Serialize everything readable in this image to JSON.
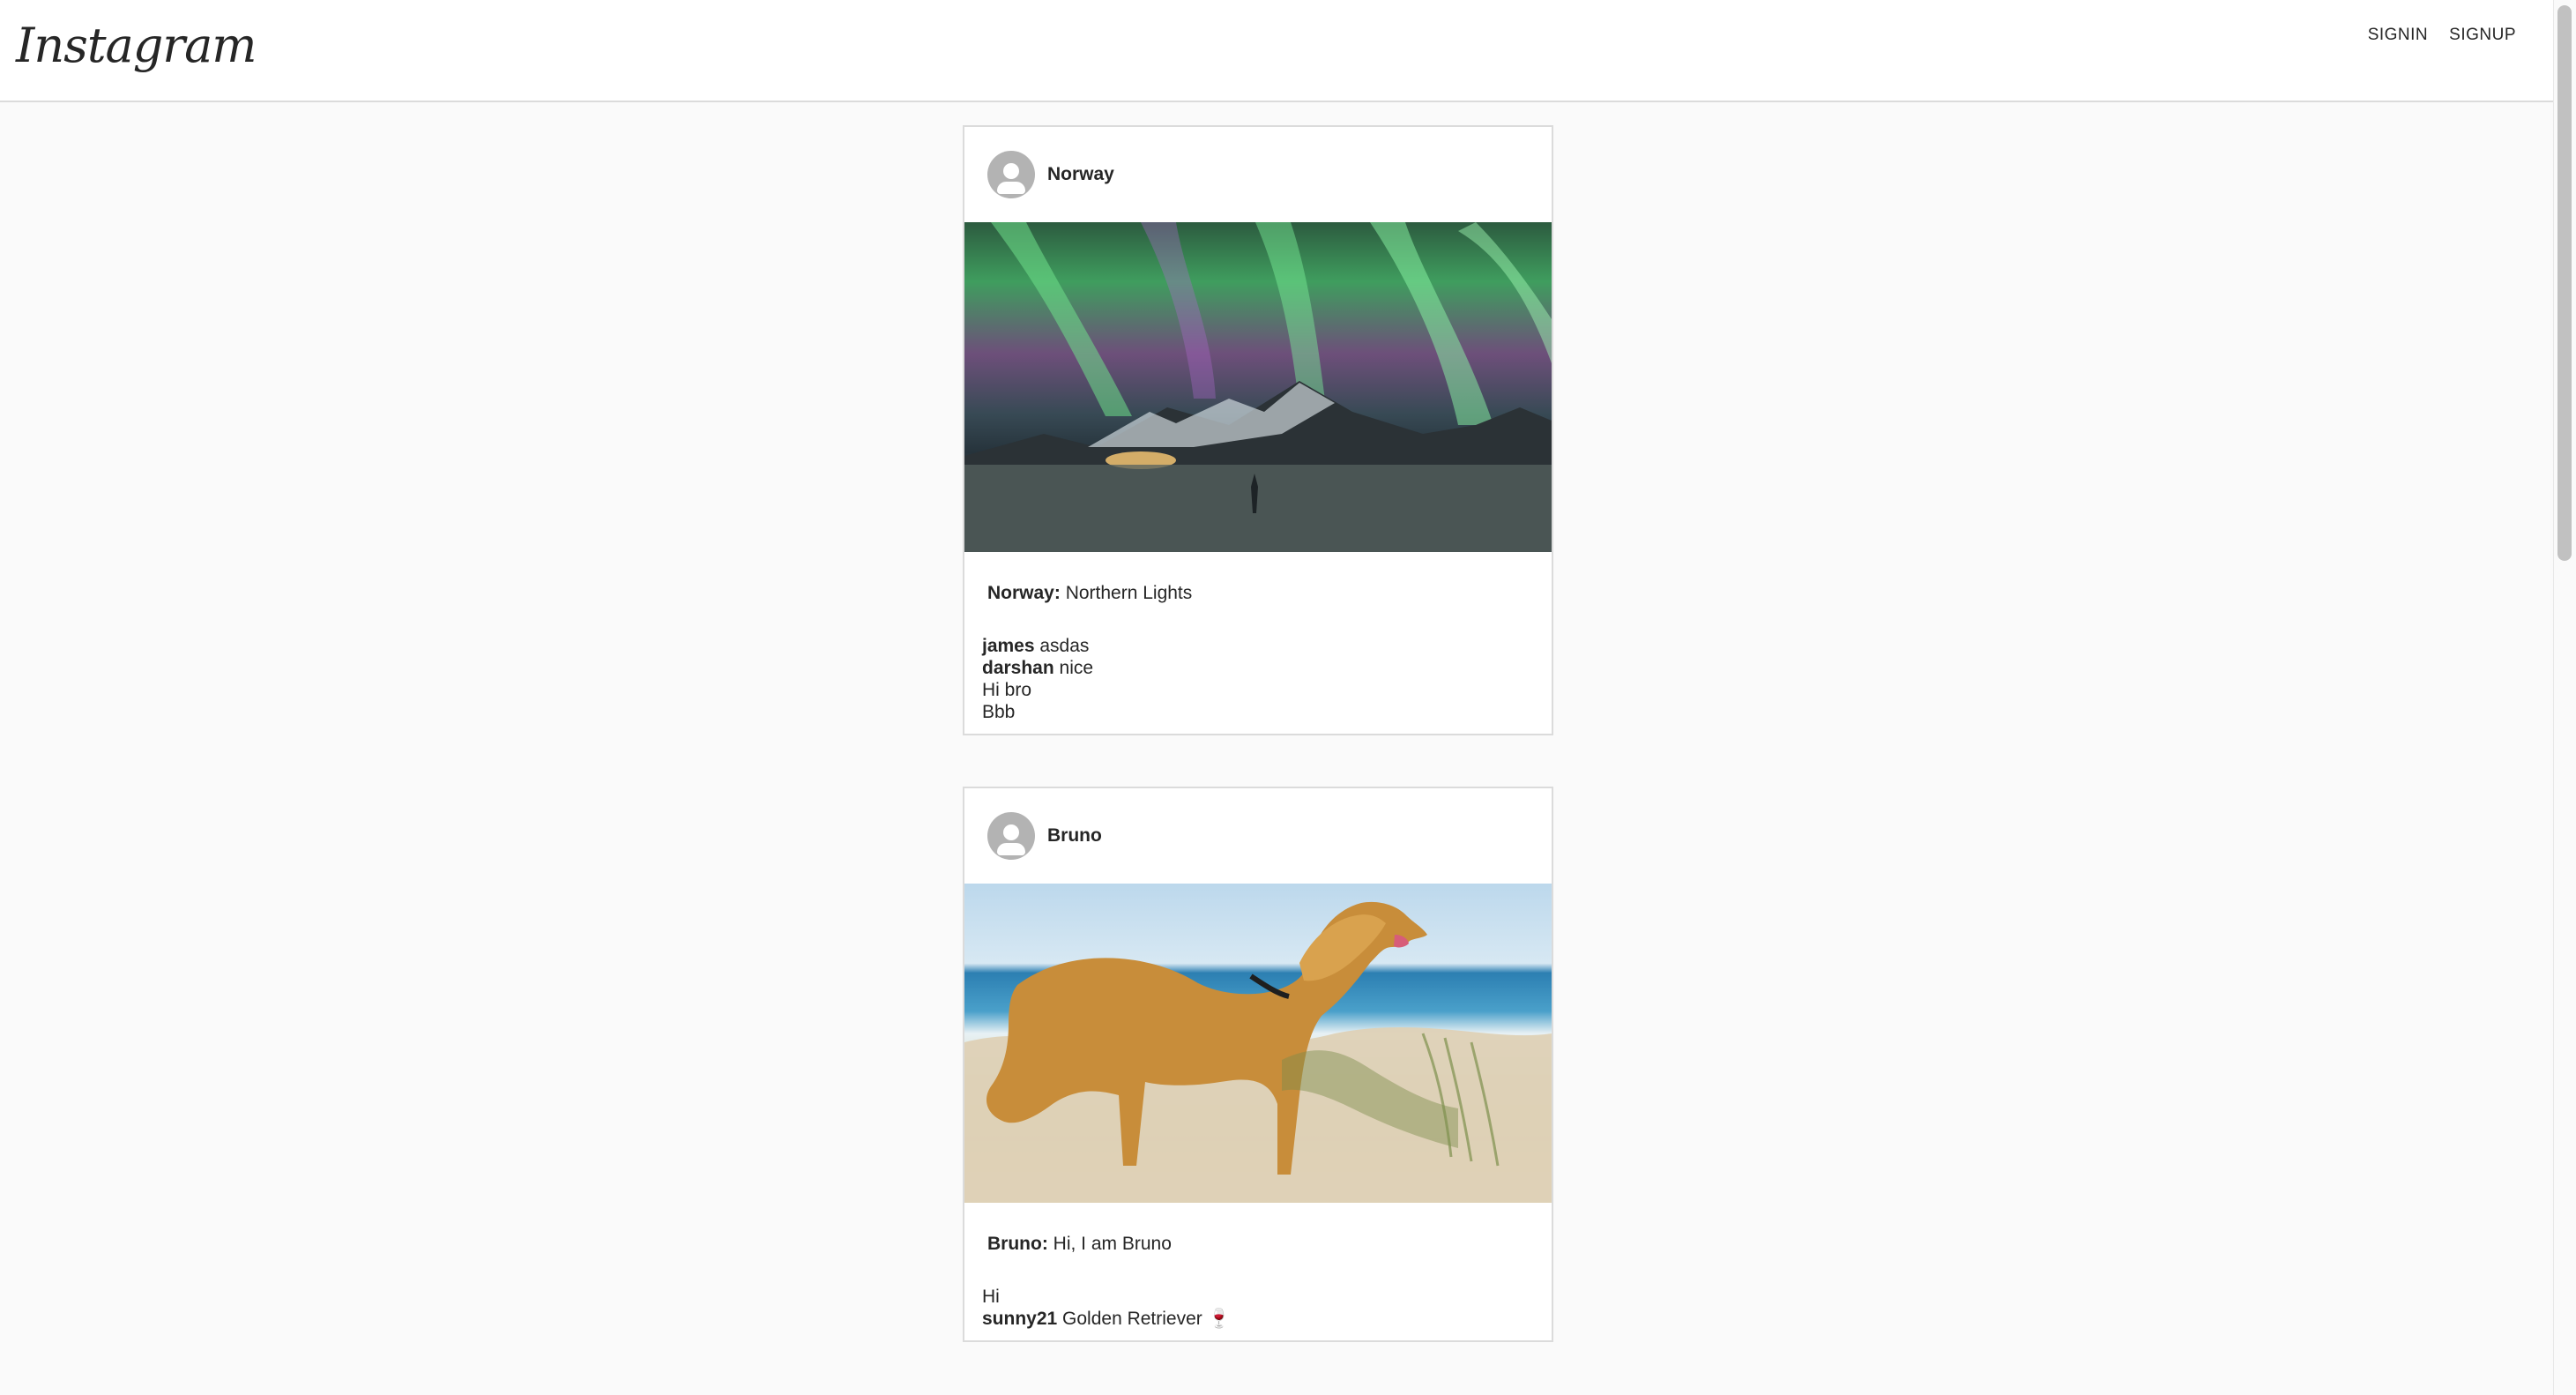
{
  "header": {
    "logo": "Instagram",
    "nav": [
      {
        "label": "SIGNIN"
      },
      {
        "label": "SIGNUP"
      }
    ]
  },
  "posts": [
    {
      "username": "Norway",
      "image_icon": "aurora-photo",
      "caption_user": "Norway:",
      "caption_text": " Northern Lights",
      "comments": [
        {
          "user": "james",
          "text": " asdas"
        },
        {
          "user": "darshan",
          "text": " nice"
        },
        {
          "user": "",
          "text": "Hi bro"
        },
        {
          "user": "",
          "text": "Bbb"
        }
      ]
    },
    {
      "username": "Bruno",
      "image_icon": "golden-retriever-photo",
      "caption_user": "Bruno:",
      "caption_text": " Hi, I am Bruno",
      "comments": [
        {
          "user": "",
          "text": "Hi"
        },
        {
          "user": "sunny21",
          "text": " Golden Retriever 🍷"
        }
      ]
    }
  ],
  "colors": {
    "page_background": "#fafafa",
    "card_border": "#dbdbdb",
    "text": "#262626",
    "avatar": "#b3b3b3"
  }
}
